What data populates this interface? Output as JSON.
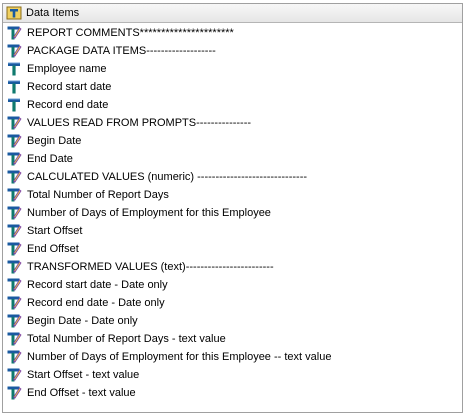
{
  "panel": {
    "title": "Data Items",
    "title_icon": "folder-data-items-icon"
  },
  "items": [
    {
      "label": "REPORT COMMENTS**********************",
      "icon": "calc"
    },
    {
      "label": "PACKAGE DATA ITEMS-------------------",
      "icon": "calc"
    },
    {
      "label": "Employee name",
      "icon": "query"
    },
    {
      "label": "Record start date",
      "icon": "query"
    },
    {
      "label": "Record end date",
      "icon": "query"
    },
    {
      "label": "VALUES READ FROM PROMPTS---------------",
      "icon": "calc"
    },
    {
      "label": "Begin Date",
      "icon": "calc"
    },
    {
      "label": "End Date",
      "icon": "calc"
    },
    {
      "label": "CALCULATED VALUES (numeric) ------------------------------",
      "icon": "calc"
    },
    {
      "label": "Total Number of Report Days",
      "icon": "calc"
    },
    {
      "label": "Number of Days of Employment for this Employee",
      "icon": "calc"
    },
    {
      "label": "Start Offset",
      "icon": "calc"
    },
    {
      "label": "End Offset",
      "icon": "calc"
    },
    {
      "label": "TRANSFORMED VALUES (text)------------------------",
      "icon": "calc"
    },
    {
      "label": "Record start date - Date only",
      "icon": "calc"
    },
    {
      "label": "Record end date - Date only",
      "icon": "calc"
    },
    {
      "label": "Begin Date - Date only",
      "icon": "calc"
    },
    {
      "label": "Total Number of Report Days - text value",
      "icon": "calc"
    },
    {
      "label": "Number of Days of Employment for this Employee -- text value",
      "icon": "calc"
    },
    {
      "label": "Start Offset - text value",
      "icon": "calc"
    },
    {
      "label": "End Offset - text value",
      "icon": "calc"
    }
  ],
  "colors": {
    "query_icon_top": "#1a5aa0",
    "query_icon_stem": "#0f7a6e",
    "calc_pencil": "#7a3fb0",
    "calc_yellow": "#e8c640"
  }
}
